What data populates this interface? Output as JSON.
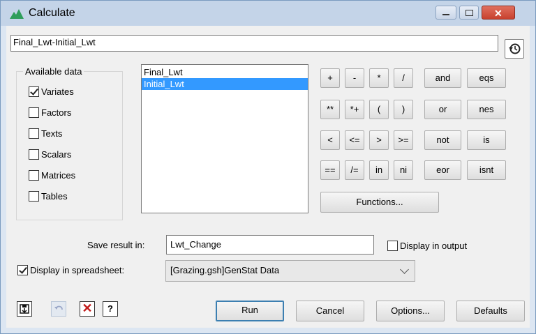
{
  "window": {
    "title": "Calculate"
  },
  "expression": {
    "value": "Final_Lwt-Initial_Lwt"
  },
  "available_data": {
    "title": "Available data",
    "options": [
      {
        "label": "Variates",
        "checked": true
      },
      {
        "label": "Factors",
        "checked": false
      },
      {
        "label": "Texts",
        "checked": false
      },
      {
        "label": "Scalars",
        "checked": false
      },
      {
        "label": "Matrices",
        "checked": false
      },
      {
        "label": "Tables",
        "checked": false
      }
    ]
  },
  "data_list": {
    "items": [
      {
        "label": "Final_Lwt",
        "selected": false
      },
      {
        "label": "Initial_Lwt",
        "selected": true
      }
    ]
  },
  "operators": {
    "row1": [
      "+",
      "-",
      "*",
      "/",
      "and",
      "eqs"
    ],
    "row2": [
      "**",
      "*+",
      "(",
      ")",
      "or",
      "nes"
    ],
    "row3": [
      "<",
      "<=",
      ">",
      ">=",
      "not",
      "is"
    ],
    "row4": [
      "==",
      "/=",
      "in",
      "ni",
      "eor",
      "isnt"
    ]
  },
  "functions_button": "Functions...",
  "save": {
    "label": "Save result in:",
    "value": "Lwt_Change"
  },
  "display_output": {
    "label": "Display in output",
    "checked": false
  },
  "display_spreadsheet": {
    "label": "Display in spreadsheet:",
    "checked": true,
    "value": "[Grazing.gsh]GenStat Data"
  },
  "buttons": {
    "run": "Run",
    "cancel": "Cancel",
    "options": "Options...",
    "defaults": "Defaults"
  },
  "toolbar": {
    "help_label": "?"
  }
}
